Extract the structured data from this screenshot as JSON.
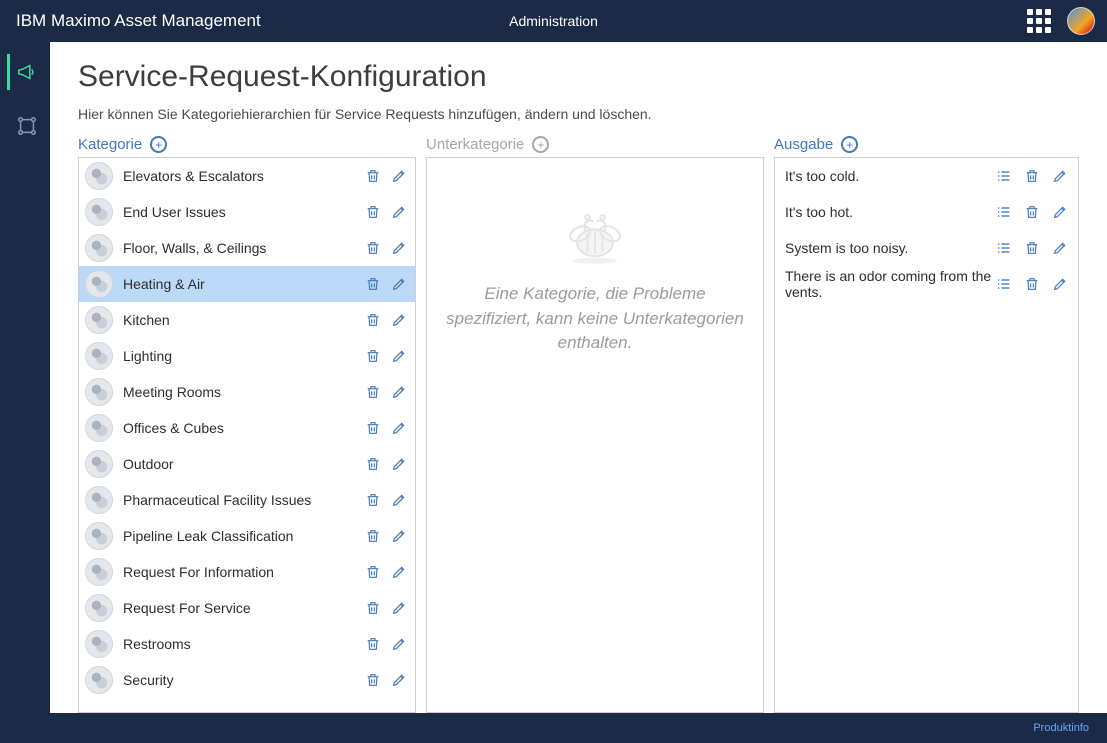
{
  "header": {
    "app_title": "IBM Maximo Asset Management",
    "center": "Administration"
  },
  "page": {
    "title": "Service-Request-Konfiguration",
    "subtitle": "Hier können Sie Kategoriehierarchien für Service Requests hinzufügen, ändern und löschen."
  },
  "columns": {
    "category": "Kategorie",
    "subcategory": "Unterkategorie",
    "issue": "Ausgabe"
  },
  "categories": [
    {
      "label": "Elevators & Escalators",
      "selected": false
    },
    {
      "label": "End User Issues",
      "selected": false
    },
    {
      "label": "Floor, Walls, & Ceilings",
      "selected": false
    },
    {
      "label": "Heating & Air",
      "selected": true
    },
    {
      "label": "Kitchen",
      "selected": false
    },
    {
      "label": "Lighting",
      "selected": false
    },
    {
      "label": "Meeting Rooms",
      "selected": false
    },
    {
      "label": "Offices & Cubes",
      "selected": false
    },
    {
      "label": "Outdoor",
      "selected": false
    },
    {
      "label": "Pharmaceutical Facility Issues",
      "selected": false
    },
    {
      "label": "Pipeline Leak Classification",
      "selected": false
    },
    {
      "label": "Request For Information",
      "selected": false
    },
    {
      "label": "Request For Service",
      "selected": false
    },
    {
      "label": "Restrooms",
      "selected": false
    },
    {
      "label": "Security",
      "selected": false
    }
  ],
  "subcategory_empty_msg": "Eine Kategorie, die Probleme spezifiziert, kann keine Unterkategorien enthalten.",
  "issues": [
    "It's too cold.",
    "It's too hot.",
    "System is too noisy.",
    "There is an odor coming from the vents."
  ],
  "footer": {
    "product_info": "Produktinfo"
  }
}
